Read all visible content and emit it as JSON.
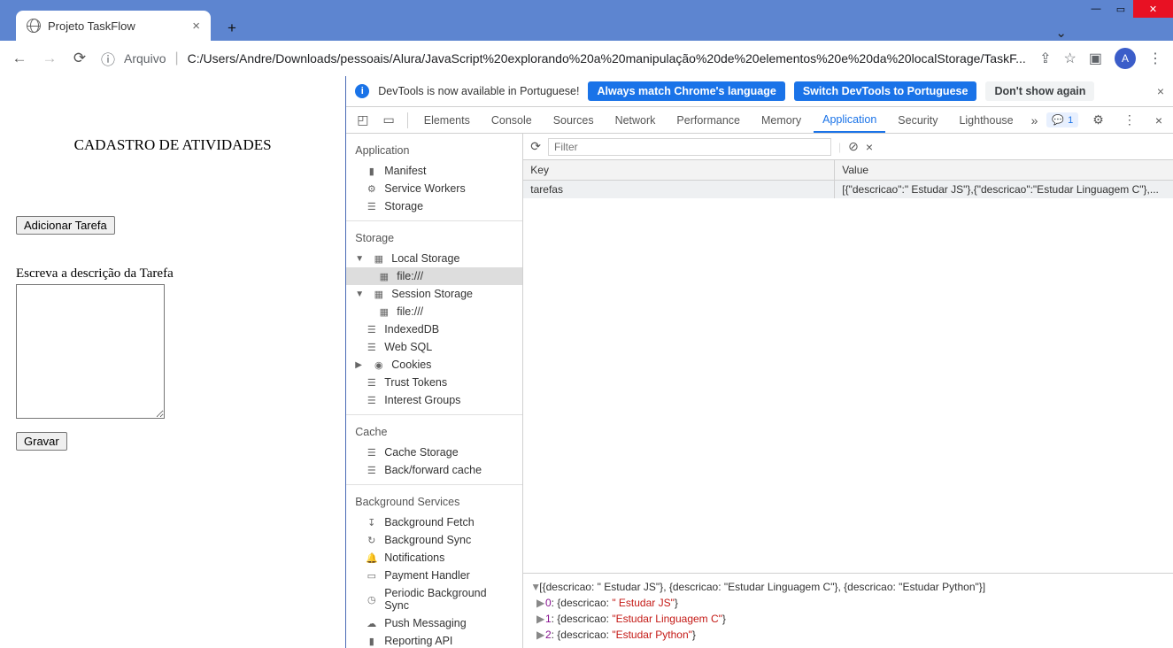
{
  "window": {
    "tab_title": "Projeto TaskFlow",
    "url_label_source": "Arquivo",
    "url": "C:/Users/Andre/Downloads/pessoais/Alura/JavaScript%20explorando%20a%20manipulação%20de%20elementos%20e%20da%20localStorage/TaskF...",
    "avatar_letter": "A"
  },
  "page": {
    "heading": "CADASTRO DE ATIVIDADES",
    "add_task_btn": "Adicionar Tarefa",
    "textarea_label": "Escreva a descrição da Tarefa",
    "save_btn": "Gravar"
  },
  "devtools": {
    "banner": {
      "message": "DevTools is now available in Portuguese!",
      "chip_match": "Always match Chrome's language",
      "chip_switch": "Switch DevTools to Portuguese",
      "chip_dont": "Don't show again"
    },
    "tabs": [
      "Elements",
      "Console",
      "Sources",
      "Network",
      "Performance",
      "Memory",
      "Application",
      "Security",
      "Lighthouse"
    ],
    "active_tab": "Application",
    "issues_count": "1",
    "sidebar": {
      "application": {
        "title": "Application",
        "items": [
          "Manifest",
          "Service Workers",
          "Storage"
        ]
      },
      "storage": {
        "title": "Storage",
        "local_storage": "Local Storage",
        "file1": "file:///",
        "session_storage": "Session Storage",
        "file2": "file:///",
        "indexeddb": "IndexedDB",
        "websql": "Web SQL",
        "cookies": "Cookies",
        "trust_tokens": "Trust Tokens",
        "interest_groups": "Interest Groups"
      },
      "cache": {
        "title": "Cache",
        "cache_storage": "Cache Storage",
        "back_forward": "Back/forward cache"
      },
      "bg": {
        "title": "Background Services",
        "fetch": "Background Fetch",
        "sync": "Background Sync",
        "notifications": "Notifications",
        "payment": "Payment Handler",
        "periodic": "Periodic Background Sync",
        "push": "Push Messaging",
        "reporting": "Reporting API"
      }
    },
    "storage_table": {
      "filter_placeholder": "Filter",
      "col_key": "Key",
      "col_value": "Value",
      "row_key": "tarefas",
      "row_value": "[{\"descricao\":\" Estudar JS\"},{\"descricao\":\"Estudar Linguagem C\"},..."
    },
    "preview": {
      "header": "[{descricao: \" Estudar JS\"}, {descricao: \"Estudar Linguagem C\"}, {descricao: \"Estudar Python\"}]",
      "items": [
        {
          "idx": "0",
          "body": "{descricao: \" Estudar JS\"}"
        },
        {
          "idx": "1",
          "body": "{descricao: \"Estudar Linguagem C\"}"
        },
        {
          "idx": "2",
          "body": "{descricao: \"Estudar Python\"}"
        }
      ]
    }
  }
}
